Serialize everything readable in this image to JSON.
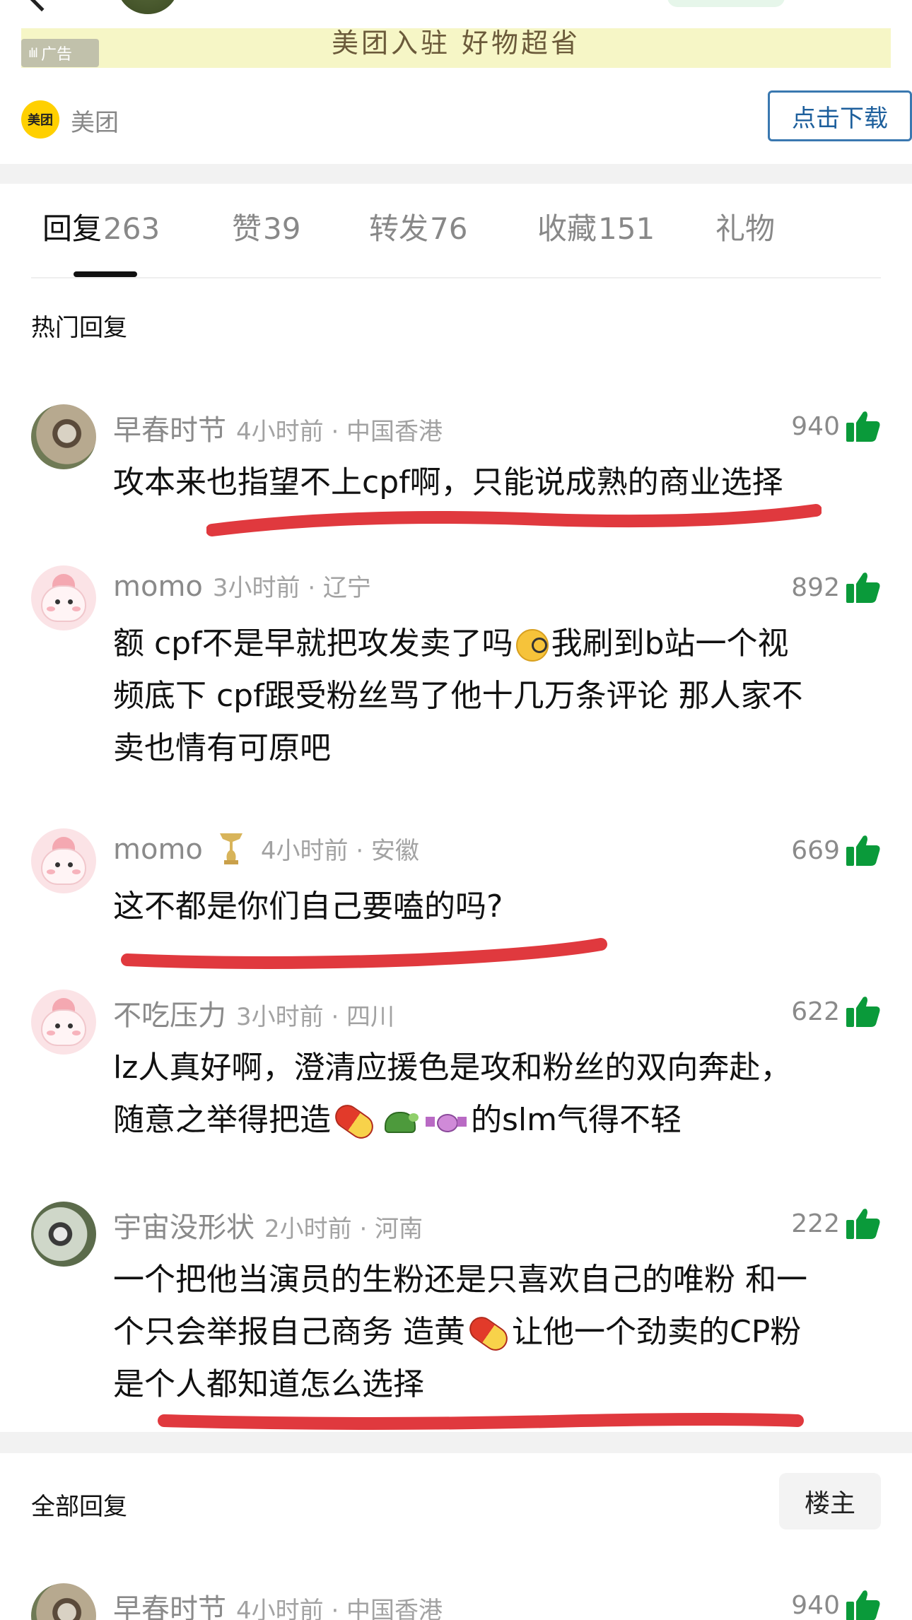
{
  "ad": {
    "banner_text": "美团入驻 好物超省",
    "tag_label": "广告",
    "advertiser": "美团",
    "logo_text": "美团",
    "download_label": "点击下载"
  },
  "tabs": [
    {
      "label": "回复",
      "count": "263",
      "active": true
    },
    {
      "label": "赞",
      "count": "39"
    },
    {
      "label": "转发",
      "count": "76"
    },
    {
      "label": "收藏",
      "count": "151"
    },
    {
      "label": "礼物",
      "count": ""
    }
  ],
  "hot_section_title": "热门回复",
  "comments": [
    {
      "user": "早春时节",
      "meta": "4小时前 · 中国香港",
      "likes": "940",
      "lines": [
        "攻本来也指望不上cpf啊，只能说成熟的商业选择"
      ]
    },
    {
      "user": "momo",
      "meta": "3小时前 · 辽宁",
      "likes": "892",
      "lines_a": "额 cpf不是早就把攻发卖了吗",
      "lines_b": "我刷到b站一个视",
      "lines_c": "频底下 cpf跟受粉丝骂了他十几万条评论 那人家不",
      "lines_d": "卖也情有可原吧"
    },
    {
      "user": "momo",
      "meta": "4小时前 · 安徽",
      "likes": "669",
      "lines": [
        "这不都是你们自己要嗑的吗?"
      ]
    },
    {
      "user": "不吃压力",
      "meta": "3小时前 · 四川",
      "likes": "622",
      "line1": "lz人真好啊，澄清应援色是攻和粉丝的双向奔赴，",
      "line2a": "随意之举得把造",
      "line2b": "的slm气得不轻"
    },
    {
      "user": "宇宙没形状",
      "meta": "2小时前 · 河南",
      "likes": "222",
      "line1": "一个把他当演员的生粉还是只喜欢自己的唯粉 和一",
      "line2a": "个只会举报自己商务 造黄",
      "line2b": "让他一个劲卖的CP粉",
      "line3": "是个人都知道怎么选择"
    }
  ],
  "all_section_title": "全部回复",
  "floor_button": "楼主",
  "last_comment": {
    "user": "早春时节",
    "meta": "4小时前 · 中国香港",
    "likes": "940"
  },
  "colors": {
    "like_green": "#0a9a3a",
    "highlight_red": "#e0393e",
    "download_blue": "#1d5f9c"
  }
}
